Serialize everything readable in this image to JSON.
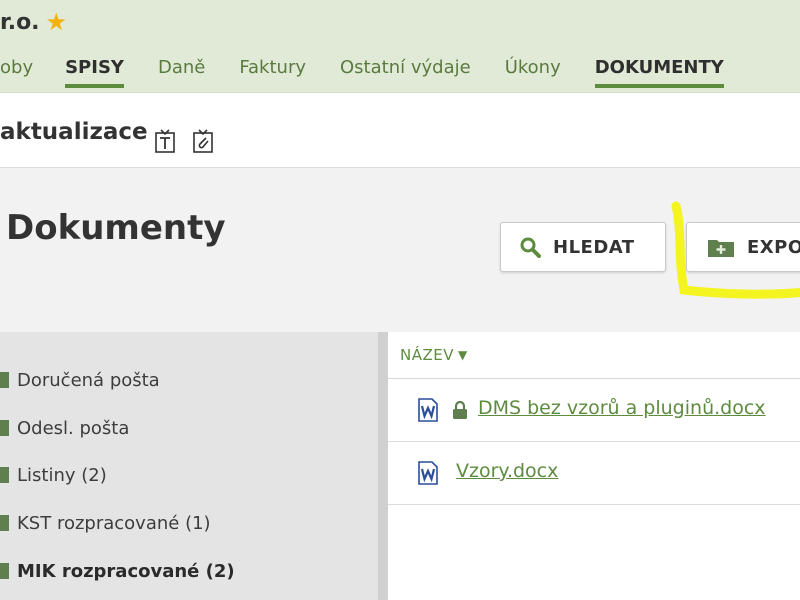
{
  "header": {
    "company_partial": "r.o.",
    "tabs": [
      {
        "label": "oby",
        "active": false
      },
      {
        "label": "SPISY",
        "active": true
      },
      {
        "label": "Daně",
        "active": false
      },
      {
        "label": "Faktury",
        "active": false
      },
      {
        "label": "Ostatní výdaje",
        "active": false
      },
      {
        "label": "Úkony",
        "active": false
      },
      {
        "label": "DOKUMENTY",
        "active": true
      }
    ]
  },
  "strip": {
    "title_partial": "aktualizace"
  },
  "section": {
    "title": "Dokumenty",
    "search_button": "HLEDAT",
    "export_button_partial": "EXPO"
  },
  "folders": [
    {
      "label": "Doručená pošta",
      "bold": false
    },
    {
      "label": "Odesl. pošta",
      "bold": false
    },
    {
      "label": "Listiny (2)",
      "bold": false
    },
    {
      "label": "KST rozpracované (1)",
      "bold": false
    },
    {
      "label": "MIK rozpracované (2)",
      "bold": true
    }
  ],
  "table": {
    "column_name": "NÁZEV",
    "rows": [
      {
        "name": "DMS bez vzorů a pluginů.docx",
        "locked": true
      },
      {
        "name": "Vzory.docx",
        "locked": false
      }
    ]
  },
  "colors": {
    "accent_green": "#5d8c3f",
    "header_bg": "#e0ead6",
    "highlight_yellow": "#f4f40a",
    "star": "#f3b20c"
  }
}
